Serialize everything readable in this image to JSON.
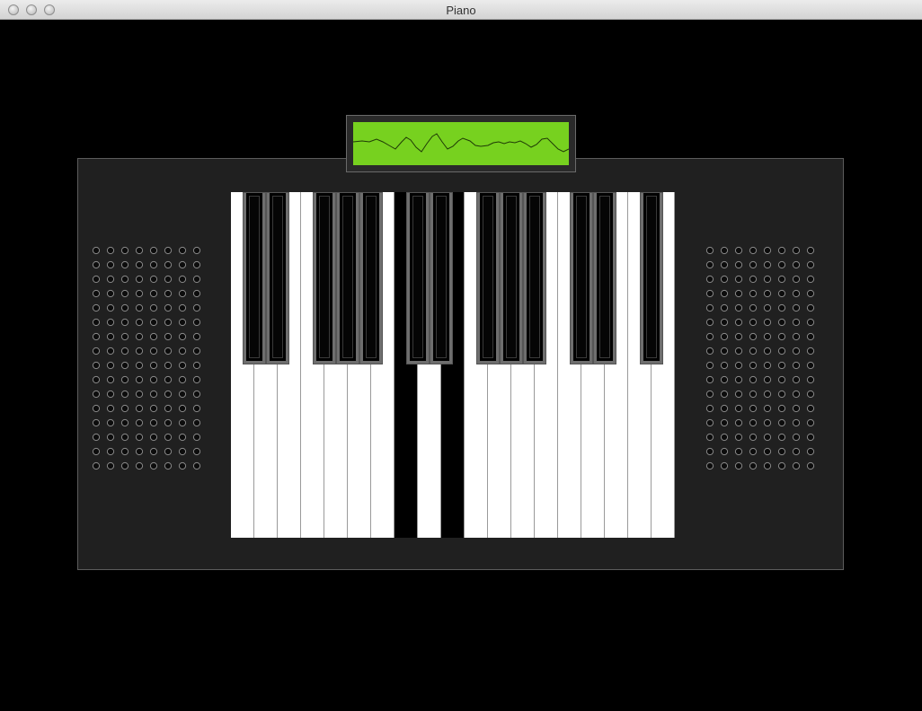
{
  "window": {
    "title": "Piano"
  },
  "colors": {
    "display": "#77d11f",
    "panel": "#202020",
    "background": "#000000"
  },
  "keyboard": {
    "white_key_count": 19,
    "pressed_white_keys": [
      7,
      9
    ],
    "black_key_count": 13
  }
}
